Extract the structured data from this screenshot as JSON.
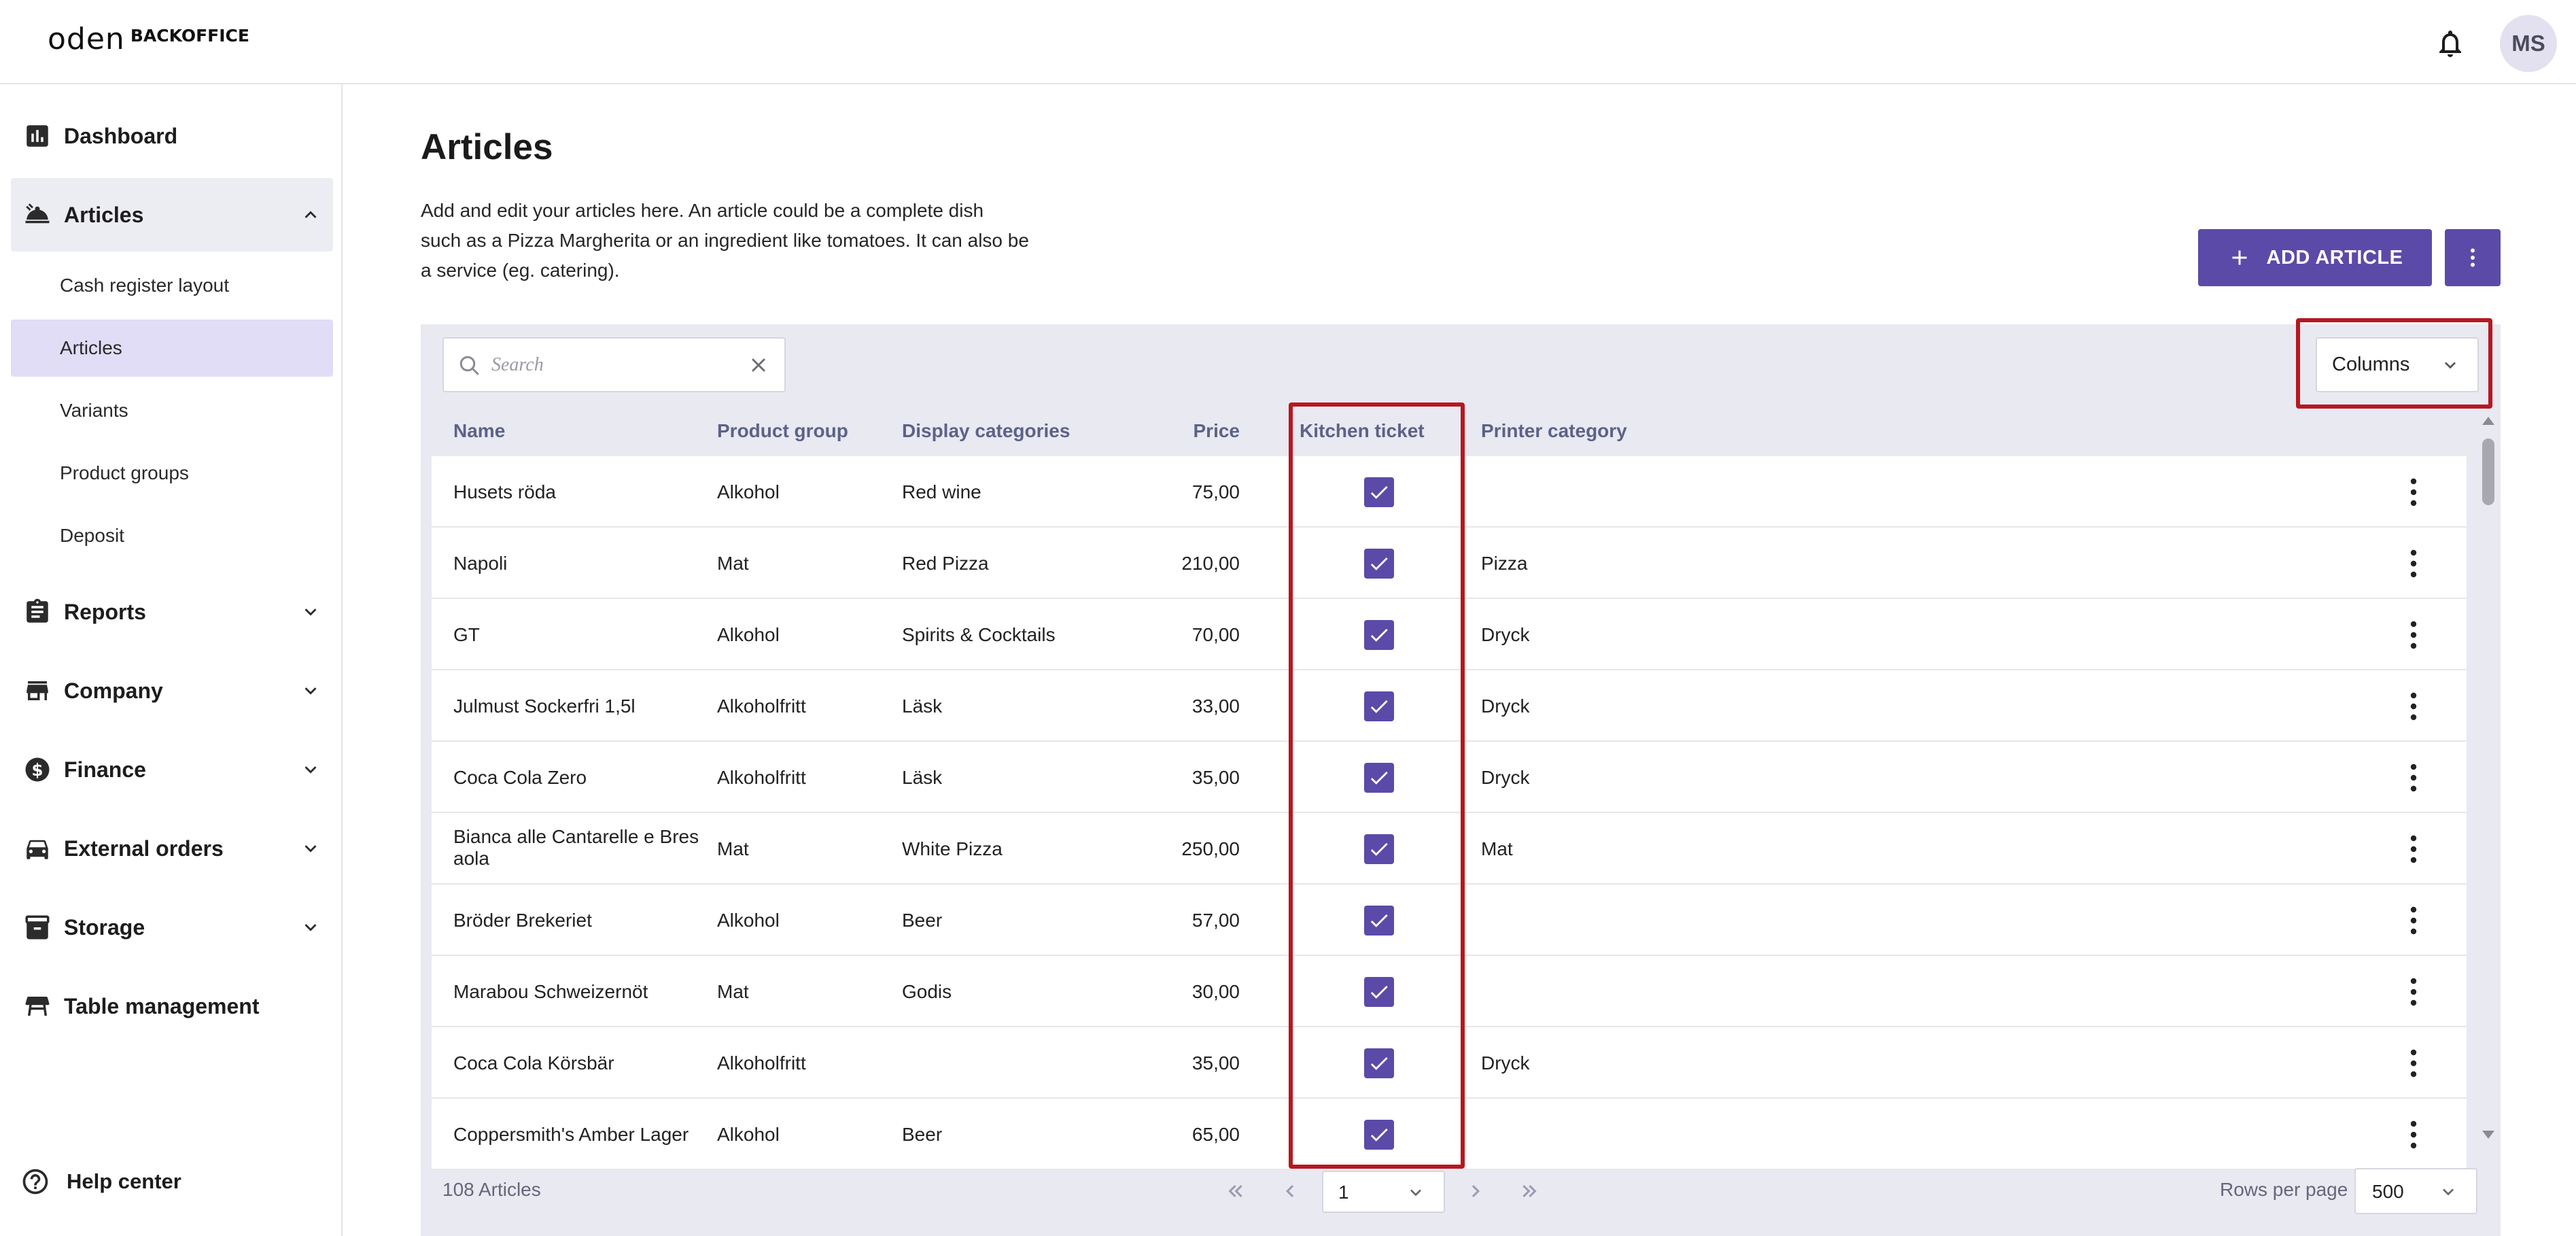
{
  "app": {
    "logo_mark": "oden",
    "logo_text": "BACKOFFICE",
    "avatar_initials": "MS"
  },
  "sidebar": {
    "items": [
      {
        "label": "Dashboard",
        "icon": "bar-chart-icon"
      },
      {
        "label": "Articles",
        "icon": "food-service-icon",
        "expanded": true,
        "subitems": [
          {
            "label": "Cash register layout"
          },
          {
            "label": "Articles",
            "active": true
          },
          {
            "label": "Variants"
          },
          {
            "label": "Product groups"
          },
          {
            "label": "Deposit"
          }
        ]
      },
      {
        "label": "Reports",
        "icon": "clipboard-icon"
      },
      {
        "label": "Company",
        "icon": "store-icon"
      },
      {
        "label": "Finance",
        "icon": "dollar-coin-icon"
      },
      {
        "label": "External orders",
        "icon": "car-icon"
      },
      {
        "label": "Storage",
        "icon": "archive-box-icon"
      },
      {
        "label": "Table management",
        "icon": "table-icon"
      }
    ],
    "help": "Help center"
  },
  "main": {
    "title": "Articles",
    "description_lines": [
      "Add and edit your articles here. An article could be a complete dish",
      "such as a Pizza Margherita or an ingredient like tomatoes. It can also be",
      "a service (eg. catering)."
    ],
    "add_button": "ADD ARTICLE"
  },
  "table": {
    "search_placeholder": "Search",
    "columns_label": "Columns",
    "headers": {
      "name": "Name",
      "product_group": "Product group",
      "display_categories": "Display categories",
      "price": "Price",
      "kitchen_ticket": "Kitchen ticket",
      "printer_category": "Printer category"
    },
    "rows": [
      {
        "name": "Husets röda",
        "group": "Alkohol",
        "display": "Red wine",
        "price": "75,00",
        "kitchen": true,
        "printer": ""
      },
      {
        "name": "Napoli",
        "group": "Mat",
        "display": "Red Pizza",
        "price": "210,00",
        "kitchen": true,
        "printer": "Pizza"
      },
      {
        "name": "GT",
        "group": "Alkohol",
        "display": "Spirits & Cocktails",
        "price": "70,00",
        "kitchen": true,
        "printer": "Dryck"
      },
      {
        "name": "Julmust Sockerfri 1,5l",
        "group": "Alkoholfritt",
        "display": "Läsk",
        "price": "33,00",
        "kitchen": true,
        "printer": "Dryck"
      },
      {
        "name": "Coca Cola Zero",
        "group": "Alkoholfritt",
        "display": "Läsk",
        "price": "35,00",
        "kitchen": true,
        "printer": "Dryck"
      },
      {
        "name": "Bianca alle Cantarelle e Bres",
        "name2": "aola",
        "group": "Mat",
        "display": "White Pizza",
        "price": "250,00",
        "kitchen": true,
        "printer": "Mat"
      },
      {
        "name": "Bröder Brekeriet",
        "group": "Alkohol",
        "display": "Beer",
        "price": "57,00",
        "kitchen": true,
        "printer": ""
      },
      {
        "name": "Marabou Schweizernöt",
        "group": "Mat",
        "display": "Godis",
        "price": "30,00",
        "kitchen": true,
        "printer": ""
      },
      {
        "name": "Coca Cola Körsbär",
        "group": "Alkoholfritt",
        "display": "",
        "price": "35,00",
        "kitchen": true,
        "printer": "Dryck"
      },
      {
        "name": "Coppersmith's Amber Lager",
        "group": "Alkohol",
        "display": "Beer",
        "price": "65,00",
        "kitchen": true,
        "printer": ""
      }
    ],
    "footer": {
      "count": "108 Articles",
      "page": "1",
      "rows_per_page_label": "Rows per page",
      "rows_per_page": "500"
    }
  },
  "colors": {
    "accent": "#5b4aa8",
    "highlight": "#b8171f",
    "active_nav": "#e1ddf6",
    "table_bg": "#e8e9f1"
  }
}
